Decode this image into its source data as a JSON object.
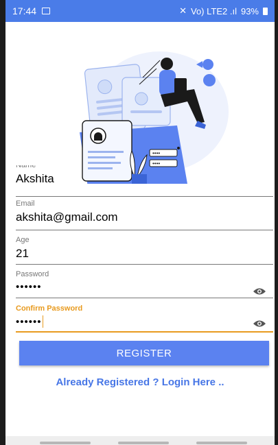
{
  "status_bar": {
    "time": "17:44",
    "network": "Vo) LTE2 .ıl",
    "battery": "93%"
  },
  "form": {
    "name": {
      "label": "Name",
      "value": "Akshita"
    },
    "email": {
      "label": "Email",
      "value": "akshita@gmail.com"
    },
    "age": {
      "label": "Age",
      "value": "21"
    },
    "password": {
      "label": "Password",
      "value": "••••••"
    },
    "confirm_password": {
      "label": "Confirm Password",
      "value": "••••••"
    }
  },
  "register_button": "REGISTER",
  "login_link": "Already Registered ? Login Here ..",
  "colors": {
    "accent": "#4a7ce8",
    "button": "#5b82f0",
    "focus": "#e89a1e",
    "link": "#4776e6"
  }
}
